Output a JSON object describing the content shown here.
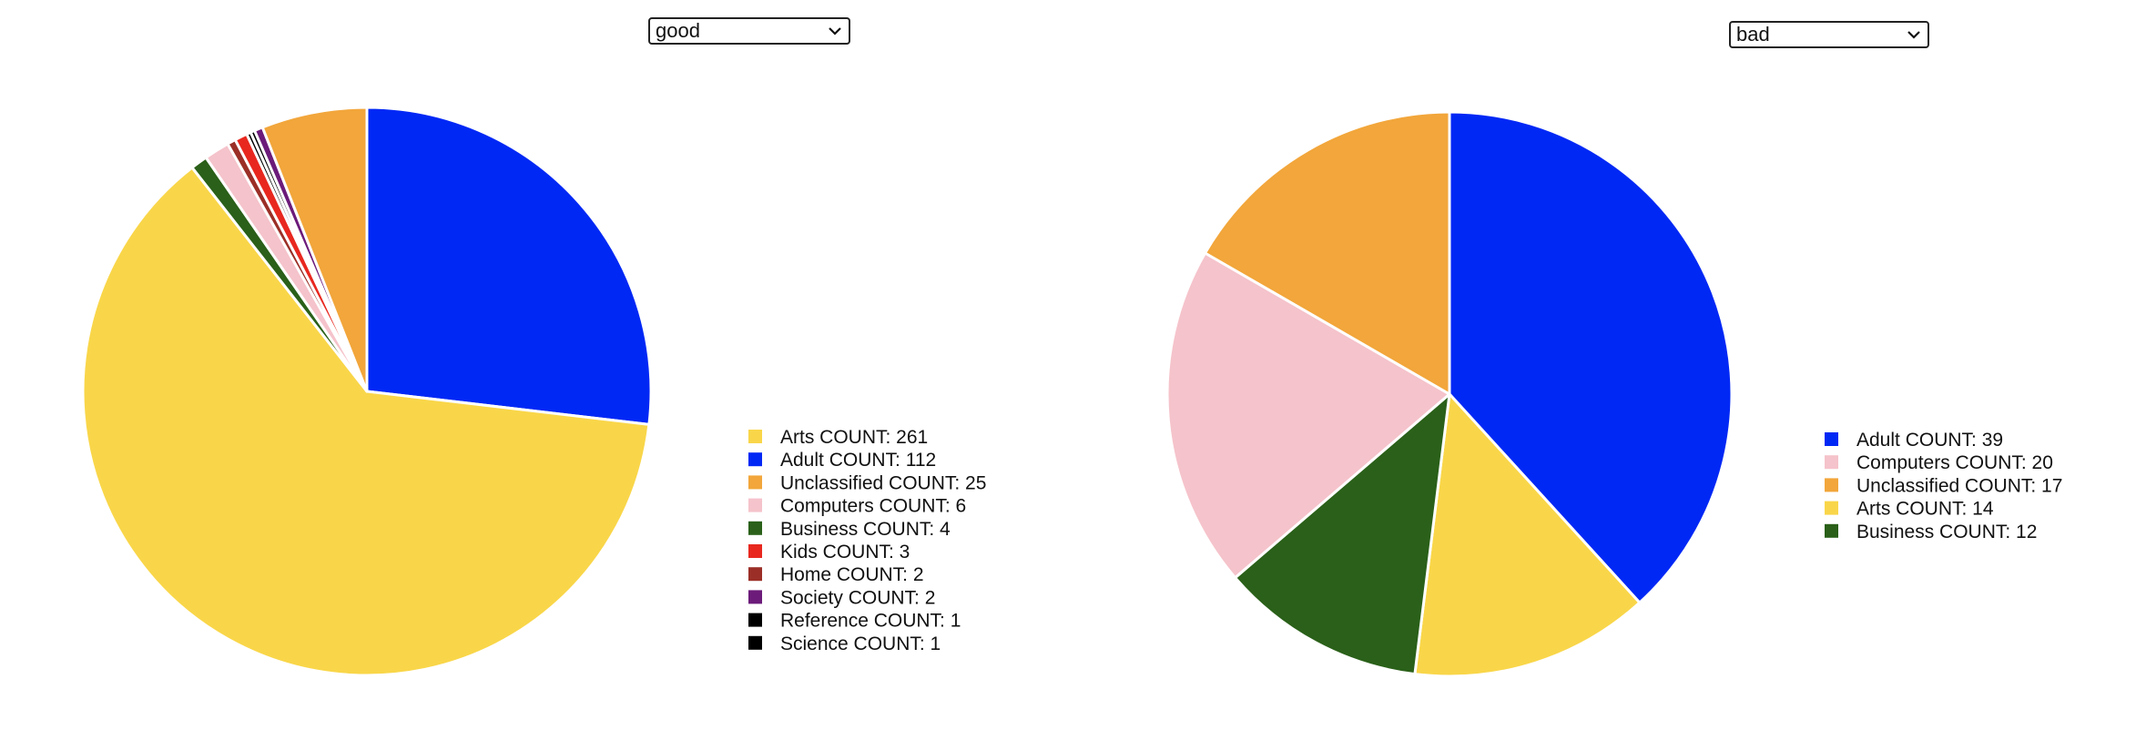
{
  "controls": [
    {
      "selected": "good"
    },
    {
      "selected": "bad"
    }
  ],
  "chart_data": [
    {
      "type": "pie",
      "start_angle_deg": 0,
      "slices": [
        {
          "label": "Adult COUNT: 112",
          "category": "Adult",
          "value": 112,
          "color": "#0028f5"
        },
        {
          "label": "Arts COUNT: 261",
          "category": "Arts",
          "value": 261,
          "color": "#f9d649"
        },
        {
          "label": "Business COUNT: 4",
          "category": "Business",
          "value": 4,
          "color": "#2a6019"
        },
        {
          "label": "Computers COUNT: 6",
          "category": "Computers",
          "value": 6,
          "color": "#f5c3cb"
        },
        {
          "label": "Home COUNT: 2",
          "category": "Home",
          "value": 2,
          "color": "#9b2f27"
        },
        {
          "label": "Kids COUNT: 3",
          "category": "Kids",
          "value": 3,
          "color": "#e8281f"
        },
        {
          "label": "Reference COUNT: 1",
          "category": "Reference",
          "value": 1,
          "color": "#000000"
        },
        {
          "label": "Science COUNT: 1",
          "category": "Science",
          "value": 1,
          "color": "#000000"
        },
        {
          "label": "Society COUNT: 2",
          "category": "Society",
          "value": 2,
          "color": "#6c1b7a"
        },
        {
          "label": "Unclassified COUNT: 25",
          "category": "Unclassified",
          "value": 25,
          "color": "#f2a63b"
        }
      ],
      "legend": {
        "placement": "right",
        "order": [
          "Arts",
          "Adult",
          "Unclassified",
          "Computers",
          "Business",
          "Kids",
          "Home",
          "Society",
          "Reference",
          "Science"
        ]
      }
    },
    {
      "type": "pie",
      "start_angle_deg": 0,
      "slices": [
        {
          "label": "Adult COUNT: 39",
          "category": "Adult",
          "value": 39,
          "color": "#0028f5"
        },
        {
          "label": "Arts COUNT: 14",
          "category": "Arts",
          "value": 14,
          "color": "#f9d649"
        },
        {
          "label": "Business COUNT: 12",
          "category": "Business",
          "value": 12,
          "color": "#2a6019"
        },
        {
          "label": "Computers COUNT: 20",
          "category": "Computers",
          "value": 20,
          "color": "#f5c3cb"
        },
        {
          "label": "Unclassified COUNT: 17",
          "category": "Unclassified",
          "value": 17,
          "color": "#f2a63b"
        }
      ],
      "legend": {
        "placement": "right",
        "order": [
          "Adult",
          "Computers",
          "Unclassified",
          "Arts",
          "Business"
        ]
      }
    }
  ]
}
